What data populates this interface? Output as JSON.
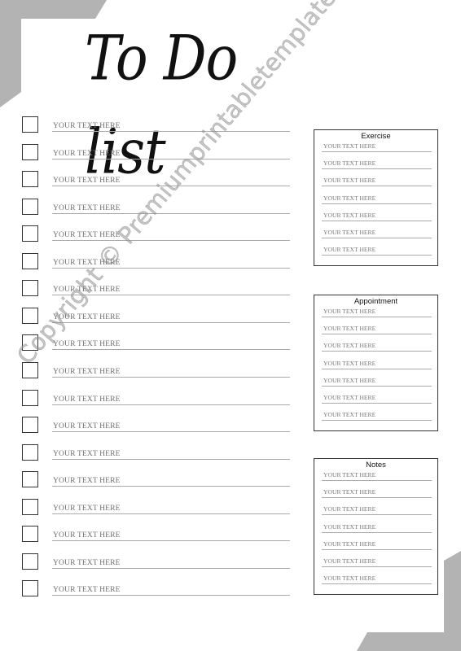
{
  "title": "To Do list",
  "todo": {
    "items": [
      {
        "text": "YOUR TEXT HERE",
        "checked": false
      },
      {
        "text": "YOUR TEXT HERE",
        "checked": false
      },
      {
        "text": "YOUR TEXT HERE",
        "checked": false
      },
      {
        "text": "YOUR TEXT HERE",
        "checked": false
      },
      {
        "text": "YOUR TEXT HERE",
        "checked": false
      },
      {
        "text": "YOUR TEXT HERE",
        "checked": false
      },
      {
        "text": "YOUR TEXT HERE",
        "checked": false
      },
      {
        "text": "YOUR TEXT HERE",
        "checked": false
      },
      {
        "text": "YOUR TEXT HERE",
        "checked": false
      },
      {
        "text": "YOUR TEXT HERE",
        "checked": false
      },
      {
        "text": "YOUR TEXT HERE",
        "checked": false
      },
      {
        "text": "YOUR TEXT HERE",
        "checked": false
      },
      {
        "text": "YOUR TEXT HERE",
        "checked": false
      },
      {
        "text": "YOUR TEXT HERE",
        "checked": false
      },
      {
        "text": "YOUR TEXT HERE",
        "checked": false
      },
      {
        "text": "YOUR TEXT HERE",
        "checked": false
      },
      {
        "text": "YOUR TEXT HERE",
        "checked": false
      },
      {
        "text": "YOUR TEXT HERE",
        "checked": false
      }
    ]
  },
  "panels": [
    {
      "id": "exercise",
      "title": "Exercise",
      "lines": [
        "YOUR TEXT HERE",
        "YOUR TEXT HERE",
        "YOUR TEXT HERE",
        "YOUR TEXT HERE",
        "YOUR TEXT HERE",
        "YOUR TEXT HERE",
        "YOUR TEXT HERE"
      ]
    },
    {
      "id": "appointment",
      "title": "Appointment",
      "lines": [
        "YOUR TEXT HERE",
        "YOUR TEXT HERE",
        "YOUR TEXT HERE",
        "YOUR TEXT HERE",
        "YOUR TEXT HERE",
        "YOUR TEXT HERE",
        "YOUR TEXT HERE"
      ]
    },
    {
      "id": "notes",
      "title": "Notes",
      "lines": [
        "YOUR TEXT HERE",
        "YOUR TEXT HERE",
        "YOUR TEXT HERE",
        "YOUR TEXT HERE",
        "YOUR TEXT HERE",
        "YOUR TEXT HERE",
        "YOUR TEXT HERE"
      ]
    }
  ],
  "watermark": "Copyright © Premiumprintabletemplates.com",
  "colors": {
    "accent_gray": "#b3b3b3",
    "ink": "#111111",
    "placeholder_text": "#6f6f6f",
    "rule_line": "#aaaaaa"
  }
}
